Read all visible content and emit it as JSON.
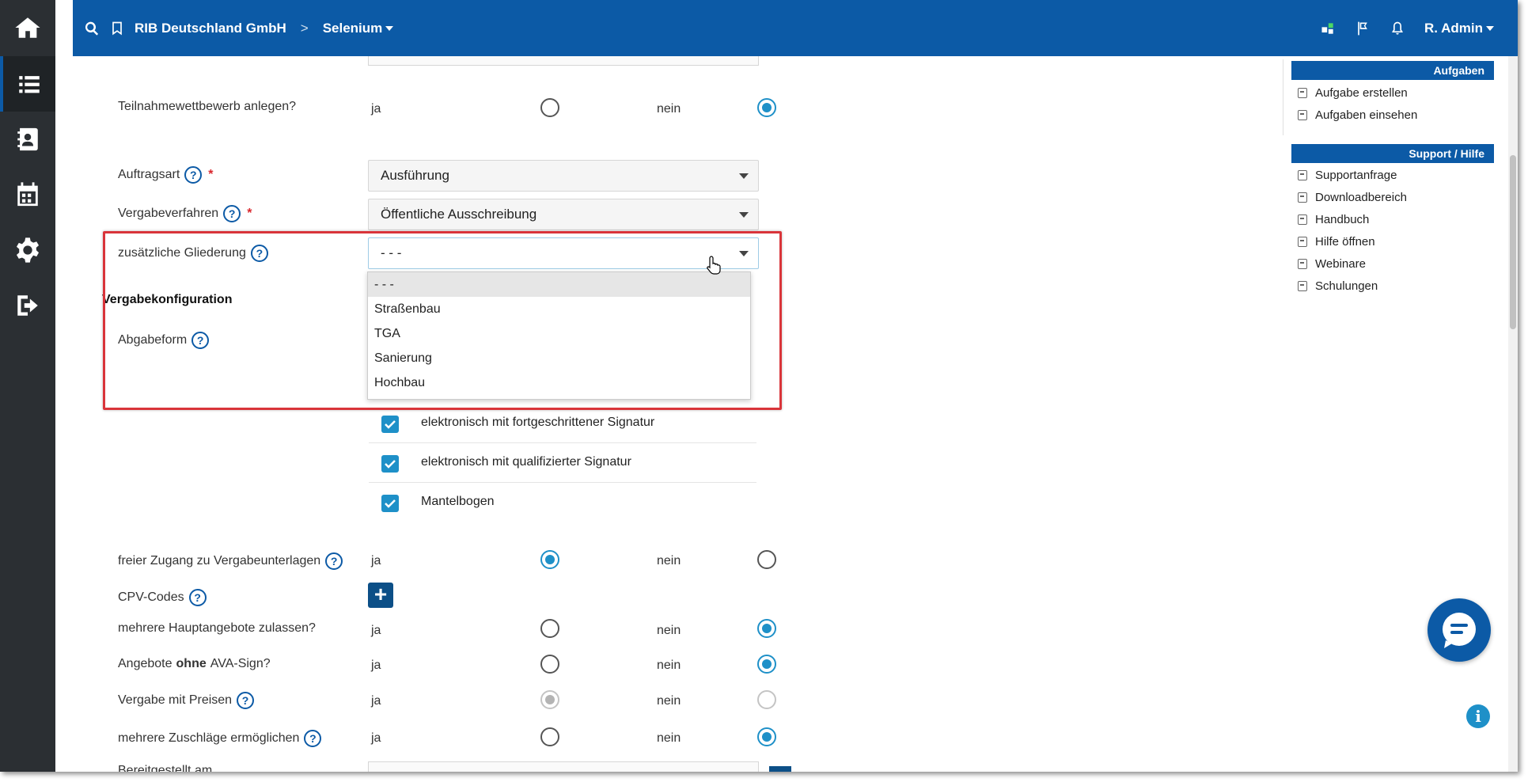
{
  "header": {
    "org": "RIB Deutschland GmbH",
    "separator": ">",
    "project": "Selenium",
    "user": "R. Admin"
  },
  "sidebar": {
    "items": [
      "home-icon",
      "list-icon",
      "contacts-icon",
      "calendar-icon",
      "settings-icon",
      "logout-icon"
    ]
  },
  "form": {
    "teilnahme": {
      "label": "Teilnahmewettbewerb anlegen?",
      "yes": "ja",
      "no": "nein",
      "selected": "nein"
    },
    "auftragsart": {
      "label": "Auftragsart",
      "help": "?",
      "required": "*",
      "value": "Ausführung"
    },
    "vergabeverfahren": {
      "label": "Vergabeverfahren",
      "help": "?",
      "required": "*",
      "value": "Öffentliche Ausschreibung"
    },
    "gliederung": {
      "label": "zusätzliche Gliederung",
      "help": "?",
      "value": "- - -",
      "options": [
        "- - -",
        "Straßenbau",
        "TGA",
        "Sanierung",
        "Hochbau"
      ]
    },
    "section_title": "Vergabekonfiguration",
    "abgabeform": {
      "label": "Abgabeform",
      "help": "?",
      "options": [
        {
          "label": "elektronisch mit fortgeschrittener Signatur",
          "checked": true
        },
        {
          "label": "elektronisch mit qualifizierter Signatur",
          "checked": true
        },
        {
          "label": "Mantelbogen",
          "checked": true
        }
      ]
    },
    "freier_zugang": {
      "label": "freier Zugang zu Vergabeunterlagen",
      "help": "?",
      "yes": "ja",
      "no": "nein",
      "selected": "ja"
    },
    "cpv": {
      "label": "CPV-Codes",
      "help": "?",
      "add": "+"
    },
    "hauptangebote": {
      "label": "mehrere Hauptangebote zulassen?",
      "yes": "ja",
      "no": "nein",
      "selected": "nein"
    },
    "ava_sign": {
      "label_pre": "Angebote",
      "label_bold": "ohne",
      "label_post": "AVA-Sign?",
      "yes": "ja",
      "no": "nein",
      "selected": "nein"
    },
    "preise": {
      "label": "Vergabe mit Preisen",
      "help": "?",
      "yes": "ja",
      "no": "nein",
      "selected": "ja",
      "disabled": true
    },
    "zuschlaege": {
      "label": "mehrere Zuschläge ermöglichen",
      "help": "?",
      "yes": "ja",
      "no": "nein",
      "selected": "nein"
    },
    "bottom_cut_label": "Bereitgestellt am"
  },
  "right_panel": {
    "aufgaben": {
      "title": "Aufgaben",
      "items": [
        "Aufgabe erstellen",
        "Aufgaben einsehen"
      ]
    },
    "support": {
      "title": "Support / Hilfe",
      "items": [
        "Supportanfrage",
        "Downloadbereich",
        "Handbuch",
        "Hilfe öffnen",
        "Webinare",
        "Schulungen"
      ]
    }
  },
  "floating": {
    "info": "i"
  },
  "colors": {
    "brand": "#0c5aa6",
    "accent": "#1e90c8",
    "sidebar": "#2b2f33",
    "highlight": "#d9343a"
  }
}
